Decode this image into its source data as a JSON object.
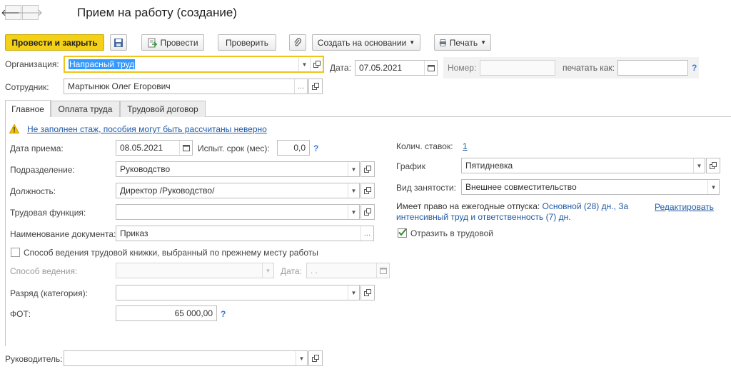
{
  "window": {
    "title": "Прием на работу (создание)"
  },
  "toolbar": {
    "post_close": "Провести и закрыть",
    "post": "Провести",
    "check": "Проверить",
    "create_based": "Создать на основании",
    "print": "Печать"
  },
  "header": {
    "org_label": "Организация:",
    "org_value": "Напрасный труд",
    "date_label": "Дата:",
    "date_value": "07.05.2021",
    "number_label": "Номер:",
    "number_value": "",
    "print_as_label": "печатать как:",
    "print_as_value": "",
    "employee_label": "Сотрудник:",
    "employee_value": "Мартынюк Олег Егорович"
  },
  "tabs": [
    {
      "label": "Главное"
    },
    {
      "label": "Оплата труда"
    },
    {
      "label": "Трудовой договор"
    }
  ],
  "main": {
    "warning": "Не заполнен стаж, пособия могут быть рассчитаны неверно",
    "hire_date_label": "Дата приема:",
    "hire_date_value": "08.05.2021",
    "probation_label": "Испыт. срок (мес):",
    "probation_value": "0,0",
    "department_label": "Подразделение:",
    "department_value": "Руководство",
    "position_label": "Должность:",
    "position_value": "Директор /Руководство/",
    "labor_function_label": "Трудовая функция:",
    "labor_function_value": "",
    "doc_name_label": "Наименование документа:",
    "doc_name_value": "Приказ",
    "workbook_checkbox_label": "Способ ведения трудовой книжки, выбранный по прежнему месту работы",
    "method_label": "Способ ведения:",
    "method_value": "",
    "method_date_label": "Дата:",
    "method_date_value": ". .",
    "grade_label": "Разряд (категория):",
    "grade_value": "",
    "fot_label": "ФОТ:",
    "fot_value": "65 000,00",
    "rates_label": "Колич. ставок:",
    "rates_value": "1",
    "schedule_label": "График",
    "schedule_value": "Пятидневка",
    "employment_label": "Вид занятости:",
    "employment_value": "Внешнее совместительство",
    "vacation_prefix": "Имеет право на ежегодные отпуска:",
    "vacation_main": "Основной (28) дн.,",
    "vacation_extra_1": "За",
    "vacation_extra_2": "интенсивный труд и ответственность (7) дн.",
    "edit_link": "Редактировать",
    "reflect_label": "Отразить в трудовой"
  },
  "footer": {
    "manager_label": "Руководитель:",
    "manager_value": ""
  },
  "colors": {
    "primary": "#f4d117",
    "link": "#1f5aa6",
    "focus": "#f0c419",
    "warning": "#e0b400"
  }
}
